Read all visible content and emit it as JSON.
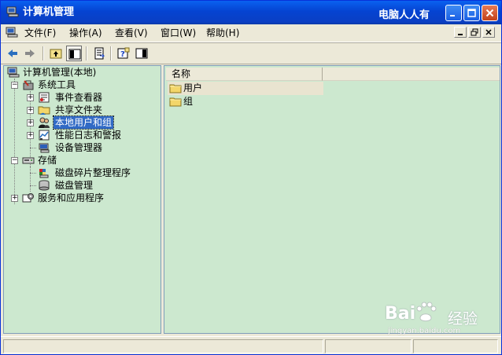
{
  "window": {
    "title": "计算机管理",
    "watermark": "电脑人人有"
  },
  "menubar": {
    "items": [
      "文件(F)",
      "操作(A)",
      "查看(V)",
      "窗口(W)",
      "帮助(H)"
    ]
  },
  "tree": {
    "root": "计算机管理(本地)",
    "system_tools": "系统工具",
    "event_viewer": "事件查看器",
    "shared_folders": "共享文件夹",
    "local_users_groups": "本地用户和组",
    "perf_logs": "性能日志和警报",
    "device_manager": "设备管理器",
    "storage": "存储",
    "defrag": "磁盘碎片整理程序",
    "disk_mgmt": "磁盘管理",
    "services_apps": "服务和应用程序"
  },
  "list": {
    "column_name": "名称",
    "items": [
      "用户",
      "组"
    ]
  },
  "watermark_brand": {
    "brand": "Bai",
    "brand_suffix": "经验",
    "url": "jingyan.baidu.com"
  },
  "colors": {
    "titlebar": "#0a61f0",
    "pane_bg": "#cce8cf",
    "selection": "#316ac5"
  }
}
